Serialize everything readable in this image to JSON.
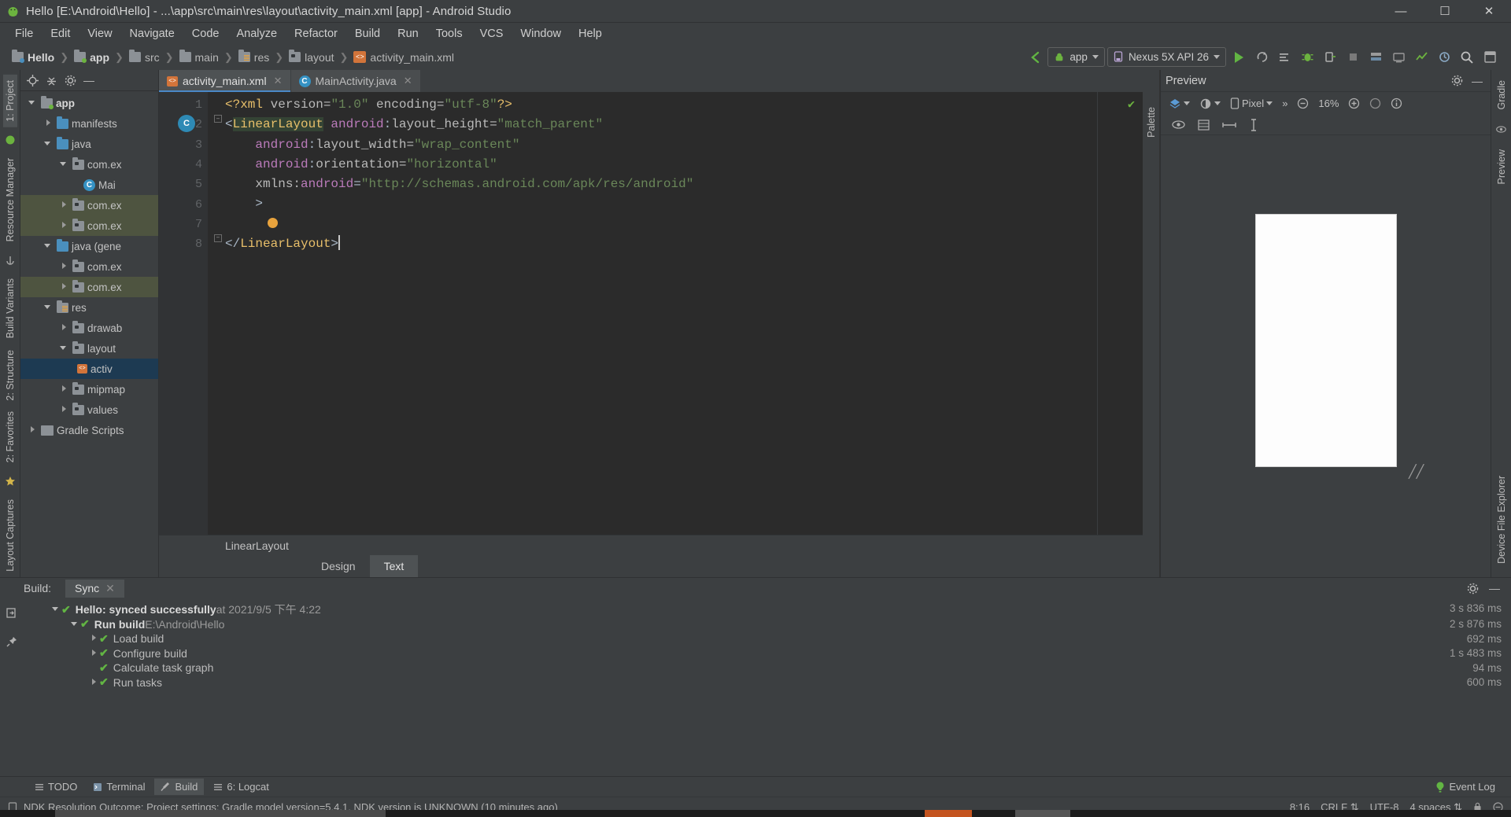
{
  "window": {
    "title": "Hello [E:\\Android\\Hello] - ...\\app\\src\\main\\res\\layout\\activity_main.xml [app] - Android Studio",
    "minimize": "—",
    "maximize": "☐",
    "close": "✕"
  },
  "menubar": [
    {
      "label": "File"
    },
    {
      "label": "Edit"
    },
    {
      "label": "View"
    },
    {
      "label": "Navigate"
    },
    {
      "label": "Code"
    },
    {
      "label": "Analyze"
    },
    {
      "label": "Refactor"
    },
    {
      "label": "Build"
    },
    {
      "label": "Run"
    },
    {
      "label": "Tools"
    },
    {
      "label": "VCS"
    },
    {
      "label": "Window"
    },
    {
      "label": "Help"
    }
  ],
  "breadcrumb": [
    {
      "label": "Hello",
      "icon": "folder-project-icon"
    },
    {
      "label": "app",
      "icon": "folder-module-icon"
    },
    {
      "label": "src",
      "icon": "folder-icon"
    },
    {
      "label": "main",
      "icon": "folder-icon"
    },
    {
      "label": "res",
      "icon": "folder-res-icon"
    },
    {
      "label": "layout",
      "icon": "folder-layout-icon"
    },
    {
      "label": "activity_main.xml",
      "icon": "xml-file-icon"
    }
  ],
  "toolbar": {
    "run_config": "app",
    "device": "Nexus 5X API 26",
    "icons": [
      "run-icon",
      "apply-changes-icon",
      "apply-code-changes-icon",
      "debug-icon",
      "attach-debugger-icon",
      "stop-icon",
      "sdk-manager-icon",
      "avd-manager-icon",
      "profiler-icon",
      "sync-gradle-icon",
      "search-icon",
      "layout-inspector-icon"
    ]
  },
  "left_strip": {
    "tabs": [
      "1: Project",
      "Resource Manager",
      "Build Variants",
      "2: Structure",
      "2: Favorites",
      "Layout Captures"
    ]
  },
  "right_strip": {
    "tabs": [
      "Gradle",
      "Preview",
      "Device File Explorer"
    ]
  },
  "project_panel": {
    "header_icons": [
      "locate-icon",
      "collapse-all-icon",
      "settings-icon",
      "hide-icon"
    ],
    "tree": [
      {
        "label": "app",
        "depth": 0,
        "arrow": "down",
        "icon": "module-folder-icon",
        "bold": true,
        "state": "normal"
      },
      {
        "label": "manifests",
        "depth": 1,
        "arrow": "right",
        "icon": "blue-folder-icon",
        "bold": false,
        "state": "normal"
      },
      {
        "label": "java",
        "depth": 1,
        "arrow": "down",
        "icon": "blue-folder-icon",
        "bold": false,
        "state": "normal"
      },
      {
        "label": "com.ex",
        "depth": 2,
        "arrow": "down",
        "icon": "package-icon",
        "bold": false,
        "state": "normal"
      },
      {
        "label": "Mai",
        "depth": 3,
        "arrow": "none",
        "icon": "java-class-icon",
        "bold": false,
        "state": "normal"
      },
      {
        "label": "com.ex",
        "depth": 2,
        "arrow": "right",
        "icon": "package-icon",
        "bold": false,
        "state": "test"
      },
      {
        "label": "com.ex",
        "depth": 2,
        "arrow": "right",
        "icon": "package-icon",
        "bold": false,
        "state": "test"
      },
      {
        "label": "java (gene",
        "depth": 1,
        "arrow": "down",
        "icon": "generated-folder-icon",
        "bold": false,
        "state": "normal"
      },
      {
        "label": "com.ex",
        "depth": 2,
        "arrow": "right",
        "icon": "package-icon",
        "bold": false,
        "state": "normal"
      },
      {
        "label": "com.ex",
        "depth": 2,
        "arrow": "right",
        "icon": "package-icon",
        "bold": false,
        "state": "test"
      },
      {
        "label": "res",
        "depth": 1,
        "arrow": "down",
        "icon": "res-folder-icon",
        "bold": false,
        "state": "normal"
      },
      {
        "label": "drawab",
        "depth": 2,
        "arrow": "right",
        "icon": "package-icon",
        "bold": false,
        "state": "normal"
      },
      {
        "label": "layout",
        "depth": 2,
        "arrow": "down",
        "icon": "package-icon",
        "bold": false,
        "state": "normal"
      },
      {
        "label": "activ",
        "depth": 3,
        "arrow": "none",
        "icon": "xml-file-icon",
        "bold": false,
        "state": "selected"
      },
      {
        "label": "mipmap",
        "depth": 2,
        "arrow": "right",
        "icon": "package-icon",
        "bold": false,
        "state": "normal"
      },
      {
        "label": "values",
        "depth": 2,
        "arrow": "right",
        "icon": "package-icon",
        "bold": false,
        "state": "normal"
      },
      {
        "label": "Gradle Scripts",
        "depth": 0,
        "arrow": "right",
        "icon": "gradle-icon",
        "bold": false,
        "state": "normal"
      }
    ]
  },
  "editor": {
    "tabs": [
      {
        "label": "activity_main.xml",
        "icon": "xml-file-icon",
        "active": true,
        "close": "✕"
      },
      {
        "label": "MainActivity.java",
        "icon": "java-class-icon",
        "active": false,
        "close": "✕"
      }
    ],
    "line_numbers": [
      "1",
      "2",
      "3",
      "4",
      "5",
      "6",
      "7",
      "8"
    ],
    "gutter_run_marker": "C",
    "code_lines": [
      "<?xml version=\"1.0\" encoding=\"utf-8\"?>",
      "<LinearLayout android:layout_height=\"match_parent\"",
      "    android:layout_width=\"wrap_content\"",
      "    android:orientation=\"horizontal\"",
      "    xmlns:android=\"http://schemas.android.com/apk/res/android\"",
      "    >",
      "",
      "</LinearLayout>"
    ],
    "status_ok": "✔",
    "component_path": "LinearLayout",
    "design_text_tabs": [
      {
        "label": "Design",
        "active": false
      },
      {
        "label": "Text",
        "active": true
      }
    ]
  },
  "preview": {
    "title": "Preview",
    "header_icons": [
      "settings-icon",
      "hide-icon"
    ],
    "theme_label": "",
    "device_label": "Pixel",
    "overflow": "»",
    "zoom": "16%",
    "zoom_out_icon": "zoom-out-icon",
    "zoom_in_icon": "zoom-in-icon",
    "zoom_fit_icon": "zoom-fit-icon",
    "info_icon": "info-icon",
    "row2_icons": [
      "eye-icon",
      "blueprint-icon",
      "horizontal-constraint-icon",
      "vertical-constraint-icon"
    ],
    "palette_label": "Palette"
  },
  "build_panel": {
    "label": "Build:",
    "tab": "Sync",
    "tab_close": "✕",
    "side_icons": [
      "expand-icon",
      "pin-icon"
    ],
    "header_icons": [
      "settings-icon",
      "hide-icon"
    ],
    "rows": [
      {
        "depth": 0,
        "arrow": "down",
        "strong": "Hello: synced successfully",
        "dim": " at 2021/9/5 下午 4:22",
        "time": "3 s 836 ms"
      },
      {
        "depth": 1,
        "arrow": "down",
        "strong": "Run build",
        "dim": " E:\\Android\\Hello",
        "time": "2 s 876 ms"
      },
      {
        "depth": 2,
        "arrow": "right",
        "strong": "",
        "dim": "Load build",
        "time": "692 ms"
      },
      {
        "depth": 2,
        "arrow": "right",
        "strong": "",
        "dim": "Configure build",
        "time": "1 s 483 ms"
      },
      {
        "depth": 2,
        "arrow": "none",
        "strong": "",
        "dim": "Calculate task graph",
        "time": "94 ms"
      },
      {
        "depth": 1,
        "arrow": "right",
        "strong": "",
        "dim": "Run tasks",
        "time": "600 ms"
      }
    ]
  },
  "bottom_tabs": [
    {
      "label": "TODO",
      "icon": "todo-icon",
      "active": false
    },
    {
      "label": "Terminal",
      "icon": "terminal-icon",
      "active": false
    },
    {
      "label": "Build",
      "icon": "build-hammer-icon",
      "active": true
    },
    {
      "label": "6: Logcat",
      "icon": "logcat-icon",
      "active": false
    }
  ],
  "event_log": {
    "label": "Event Log",
    "icon": "event-log-icon"
  },
  "statusbar": {
    "message": "NDK Resolution Outcome: Project settings: Gradle model version=5.4.1, NDK version is UNKNOWN (10 minutes ago)",
    "caret": "8:16",
    "line_sep": "CRLF",
    "encoding": "UTF-8",
    "indent": "4 spaces",
    "lock_icon": "lock-icon",
    "inspection_icon": "inspection-icon"
  },
  "colors": {
    "bg": "#3c3f41",
    "editor_bg": "#2b2b2b",
    "accent_blue": "#4a88c7",
    "green": "#62b543",
    "selection": "#1d3a52",
    "orange": "#d2743a"
  }
}
